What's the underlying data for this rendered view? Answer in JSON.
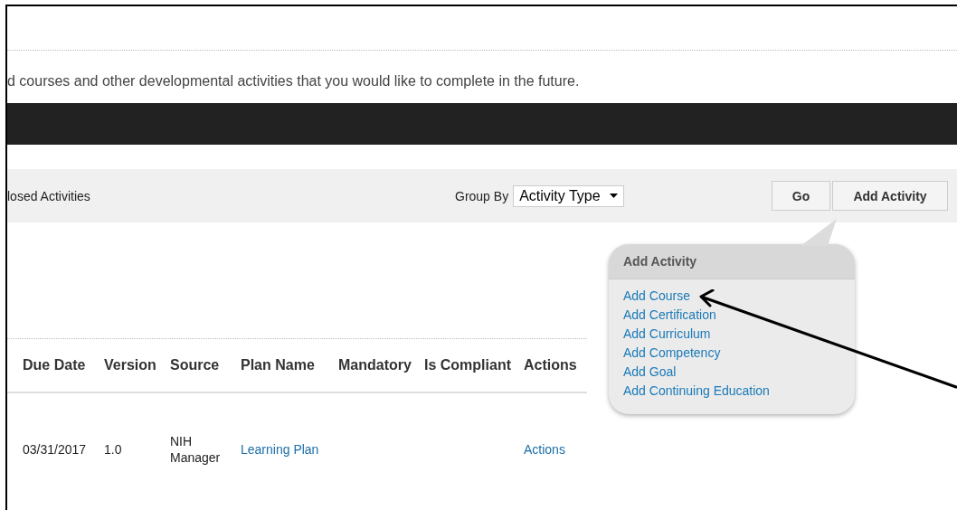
{
  "intro": "d courses and other developmental activities that you would like to complete in the future.",
  "toolbar": {
    "filter_label": "losed Activities",
    "group_by_label": "Group By",
    "group_by_value": "Activity Type",
    "go_button": "Go",
    "add_button": "Add Activity"
  },
  "popup": {
    "title": "Add Activity",
    "items": [
      "Add Course",
      "Add Certification",
      "Add Curriculum",
      "Add Competency",
      "Add Goal",
      "Add Continuing Education"
    ]
  },
  "table": {
    "columns": [
      "Due Date",
      "Version",
      "Source",
      "Plan Name",
      "Mandatory",
      "Is Compliant",
      "Actions"
    ],
    "rows": [
      {
        "cells": [
          {
            "kind": "text",
            "text": "03/31/2017"
          },
          {
            "kind": "text",
            "text": "1.0"
          },
          {
            "kind": "lines",
            "lines": [
              "NIH",
              "Manager"
            ]
          },
          {
            "kind": "link",
            "text": "Learning Plan"
          },
          {
            "kind": "text",
            "text": ""
          },
          {
            "kind": "text",
            "text": ""
          },
          {
            "kind": "link",
            "text": "Actions"
          }
        ]
      }
    ]
  }
}
